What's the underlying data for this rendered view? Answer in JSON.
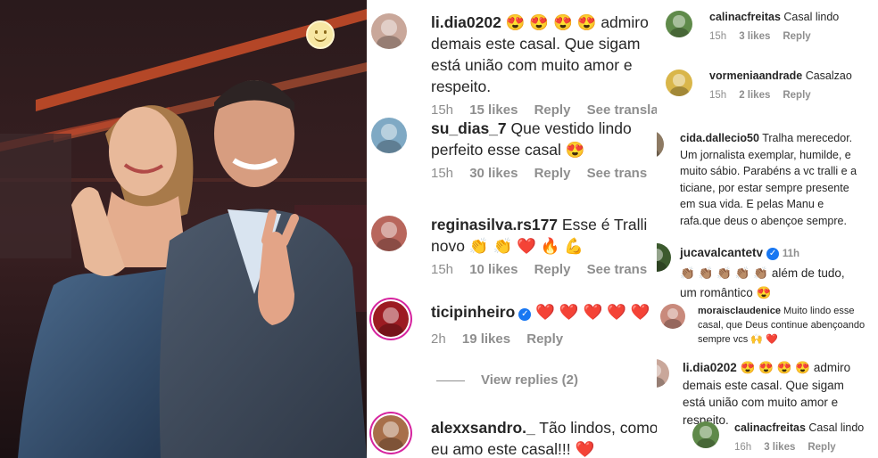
{
  "colors": {
    "meta": "#8e8e8e",
    "heart": "#ed1c24",
    "verified": "#1877f2",
    "ring": "#d6249f"
  },
  "photo": {
    "sticker": "smiley-sticker-icon"
  },
  "middle": [
    {
      "user": "li.dia0202",
      "text": "admiro demais este casal. Que sigam está união com muito amor e respeito.",
      "emoji_prefix": "😍 😍 😍 😍",
      "time": "15h",
      "likes": "15 likes",
      "reply": "Reply",
      "translate": "See translation"
    },
    {
      "user": "su_dias_7",
      "text": "Que vestido lindo perfeito esse casal",
      "emoji_suffix": "😍",
      "time": "15h",
      "likes": "30 likes",
      "reply": "Reply",
      "translate": "See trans"
    },
    {
      "user": "reginasilva.rs177",
      "text": "Esse é Tralli novo",
      "emoji_suffix": "👏 👏 ❤️ 🔥 💪",
      "time": "15h",
      "likes": "10 likes",
      "reply": "Reply",
      "translate": "See trans"
    },
    {
      "user": "ticipinheiro",
      "verified": true,
      "hearts": "❤️ ❤️ ❤️ ❤️ ❤️",
      "time": "2h",
      "likes": "19 likes",
      "reply": "Reply"
    },
    {
      "user": "alexxsandro._",
      "text": "Tão lindos, como eu amo este casal!!!",
      "emoji_suffix": "❤️"
    }
  ],
  "view_replies": "View replies (2)",
  "right": [
    {
      "user": "calinacfreitas",
      "text": "Casal lindo",
      "time": "15h",
      "likes": "3 likes",
      "reply": "Reply"
    },
    {
      "user": "vormeniaandrade",
      "text": "Casalzao",
      "time": "15h",
      "likes": "2 likes",
      "reply": "Reply"
    },
    {
      "user": "cida.dallecio50",
      "text": "Tralha merecedor. Um jornalista exemplar, humilde, e muito sábio. Parabéns a vc tralli e a ticiane, por estar sempre presente em sua vida. E pelas Manu e rafa.que deus o abençoe sempre."
    },
    {
      "user": "jucavalcantetv",
      "verified": true,
      "time_inline": "11h",
      "emoji_prefix": "👏🏽 👏🏽 👏🏽 👏🏽 👏🏽",
      "text": "além de tudo, um romântico",
      "emoji_suffix": "😍"
    },
    {
      "user": "moraisclaudenice",
      "text": "Muito lindo esse casal, que Deus continue abençoando sempre vcs",
      "emoji_suffix": "🙌 ❤️"
    },
    {
      "user": "li.dia0202",
      "text": "admiro demais este casal. Que sigam está união com muito amor e respeito.",
      "emoji_prefix": "😍 😍 😍 😍"
    },
    {
      "user": "calinacfreitas",
      "text": "Casal lindo",
      "time": "16h",
      "likes": "3 likes",
      "reply": "Reply"
    }
  ]
}
